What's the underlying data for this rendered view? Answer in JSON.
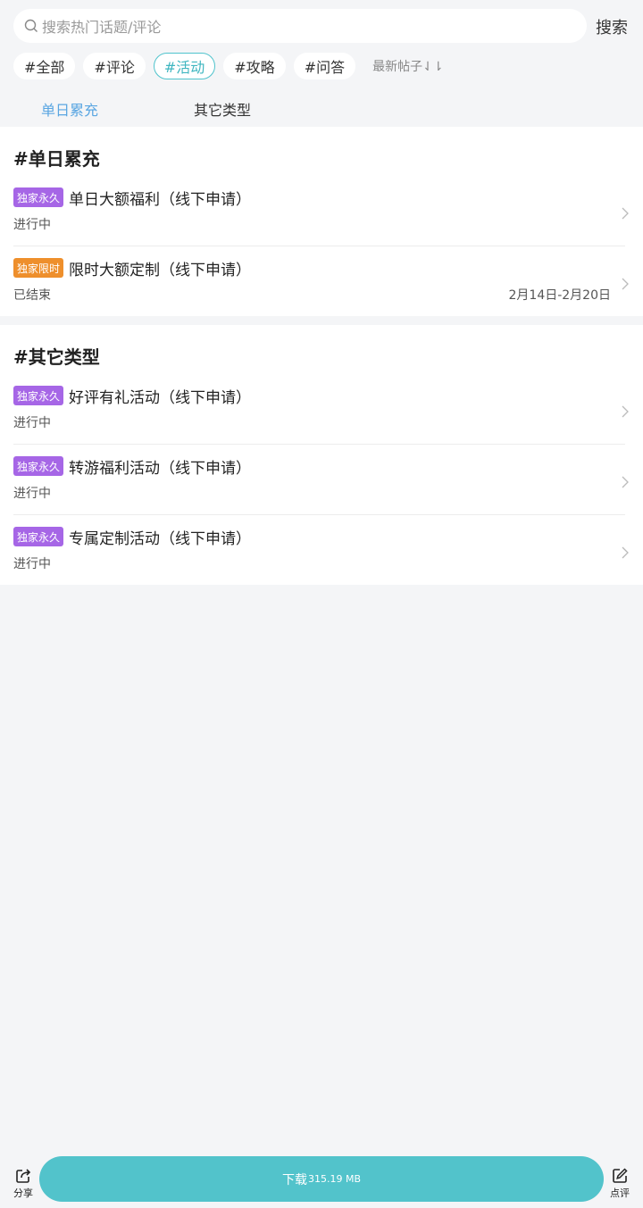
{
  "search": {
    "placeholder": "搜索热门话题/评论",
    "button_label": "搜索"
  },
  "chips": [
    "#全部",
    "#评论",
    "#活动",
    "#攻略",
    "#问答"
  ],
  "sort_label": "最新帖子⇃⇂",
  "subtabs": [
    "单日累充",
    "其它类型"
  ],
  "sections": [
    {
      "title": "#单日累充",
      "items": [
        {
          "tag": "独家永久",
          "title": "单日大额福利（线下申请）",
          "status": "进行中",
          "date": ""
        },
        {
          "tag": "独家限时",
          "title": "限时大额定制（线下申请）",
          "status": "已结束",
          "date": "2月14日-2月20日"
        }
      ]
    },
    {
      "title": "#其它类型",
      "items": [
        {
          "tag": "独家永久",
          "title": "好评有礼活动（线下申请）",
          "status": "进行中",
          "date": ""
        },
        {
          "tag": "独家永久",
          "title": "转游福利活动（线下申请）",
          "status": "进行中",
          "date": ""
        },
        {
          "tag": "独家永久",
          "title": "专属定制活动（线下申请）",
          "status": "进行中",
          "date": ""
        }
      ]
    }
  ],
  "bottom": {
    "share_label": "分享",
    "download_label": "下载",
    "download_size": "315.19 MB",
    "review_label": "点评"
  },
  "colors": {
    "accent": "#52c3cb",
    "tab_active": "#5aa6e2",
    "tag_permanent": "#a666e6",
    "tag_limited": "#ee8f2c"
  }
}
